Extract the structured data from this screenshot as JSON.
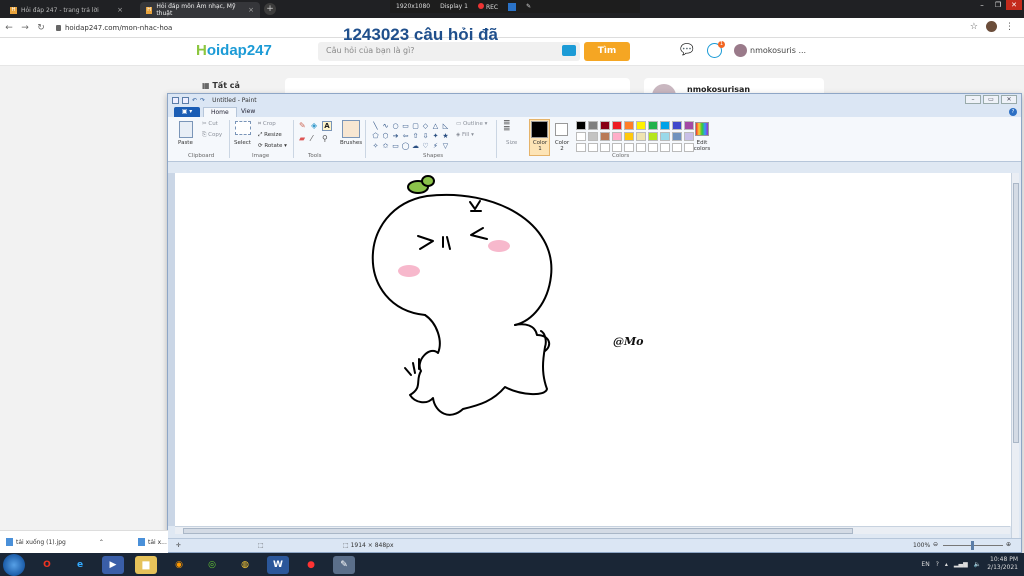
{
  "recorder": {
    "resolution": "1920x1080",
    "display": "Display 1",
    "rec": "REC"
  },
  "browser": {
    "tabs": [
      {
        "title": "Hỏi đáp 247 - trang trả lời"
      },
      {
        "title": "Hỏi đáp môn Âm nhạc, Mỹ thuật"
      }
    ],
    "url": "hoidap247.com/mon-nhac-hoa"
  },
  "site": {
    "logo_main": "oidap247",
    "logo_h": "H",
    "search_placeholder": "Câu hỏi của bạn là gì?",
    "find_label": "Tìm",
    "notif_count": "1",
    "user_short": "nmokosuris ...",
    "all_label": "Tất cả",
    "question_count": "1243023 câu hỏi đã",
    "user_card_name": "nmokosurisan"
  },
  "paint": {
    "title": "Untitled - Paint",
    "tabs": {
      "home": "Home",
      "view": "View"
    },
    "clipboard": {
      "paste": "Paste",
      "cut": "Cut",
      "copy": "Copy",
      "label": "Clipboard"
    },
    "image": {
      "select": "Select",
      "crop": "Crop",
      "resize": "Resize",
      "rotate": "Rotate",
      "label": "Image"
    },
    "tools_label": "Tools",
    "brushes": "Brushes",
    "shapes": {
      "outline": "Outline",
      "fill": "Fill",
      "label": "Shapes"
    },
    "size": "Size",
    "color1": "Color 1",
    "color2": "Color 2",
    "colors_label": "Colors",
    "edit_colors": "Edit colors",
    "palette": [
      "#000000",
      "#7f7f7f",
      "#880015",
      "#ed1c24",
      "#ff7f27",
      "#fff200",
      "#22b14c",
      "#00a2e8",
      "#3f48cc",
      "#a349a4",
      "#ffffff",
      "#c3c3c3",
      "#b97a57",
      "#ffaec9",
      "#ffc90e",
      "#efe4b0",
      "#b5e61d",
      "#99d9ea",
      "#7092be",
      "#c8bfe7",
      "#ffffff",
      "#ffffff",
      "#ffffff",
      "#ffffff",
      "#ffffff",
      "#ffffff",
      "#ffffff",
      "#ffffff",
      "#ffffff",
      "#ffffff"
    ],
    "watermark": "@Mo",
    "dimensions": "1914 × 848px",
    "zoom": "100%"
  },
  "downloads": [
    {
      "name": "tải xuống (1).jpg"
    },
    {
      "name": "tải x..."
    }
  ],
  "taskbar": {
    "lang": "EN",
    "time": "10:48 PM",
    "date": "2/13/2021"
  }
}
